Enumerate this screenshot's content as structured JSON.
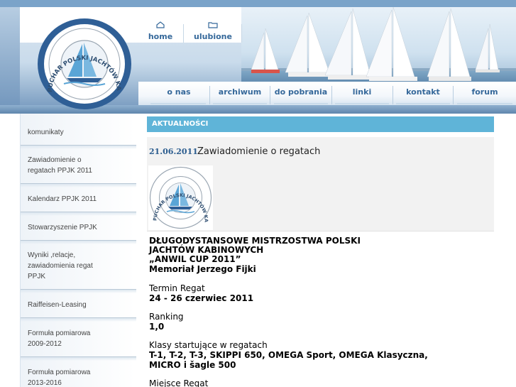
{
  "logo": {
    "ring_text": "PUCHAR POLSKI JACHTÓW KABINOWYCH"
  },
  "top_nav": {
    "home": "home",
    "favorites": "ulubione"
  },
  "main_nav": [
    "o nas",
    "archiwum",
    "do pobrania",
    "linki",
    "kontakt",
    "forum"
  ],
  "sidebar": {
    "items": [
      "komunikaty",
      "Zawiadomienie o regatach PPJK 2011",
      "Kalendarz PPJK 2011",
      "Stowarzyszenie PPJK",
      "Wyniki ,relacje, zawiadomienia regat PPJK",
      "Raiffeisen-Leasing",
      "Formuła pomiarowa 2009-2012",
      "Formuła pomiarowa 2013-2016"
    ]
  },
  "content": {
    "section_title": "AKTUALNOŚCI",
    "news_date": "21.06.2011",
    "news_title": "Zawiadomienie o regatach",
    "heading_lines": [
      "DŁUGODYSTANSOWE MISTRZOSTWA POLSKI",
      "JACHTÓW KABINOWYCH",
      "„ANWIL CUP 2011”",
      "Memoriał Jerzego Fijki"
    ],
    "termin_label": "Termin Regat",
    "termin_value": "24 - 26 czerwiec 2011",
    "ranking_label": "Ranking",
    "ranking_value": "1,0",
    "klasy_label": "Klasy startujące w regatach",
    "klasy_value_1": "T-1, T-2, T-3, SKIPPI 650, OMEGA Sport, OMEGA Klasyczna,",
    "klasy_value_2": "MICRO i šagle 500",
    "miejsce_label": "Miejsce Regat"
  },
  "colors": {
    "accent": "#5fb4d8",
    "nav_text": "#35689a",
    "header_blue": "#6f94bb"
  }
}
